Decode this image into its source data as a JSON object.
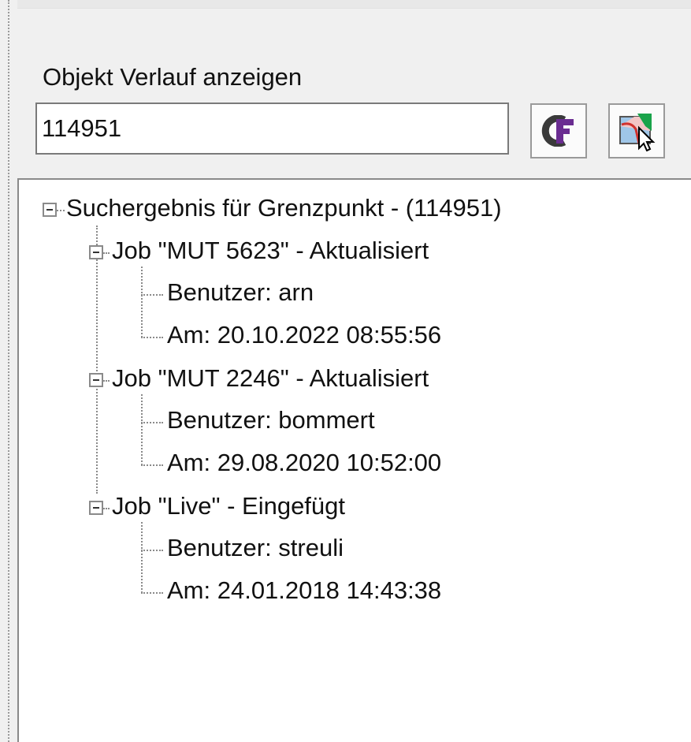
{
  "history_label": "Objekt Verlauf anzeigen",
  "search": {
    "value": "114951"
  },
  "buttons": {
    "history_icon": "history-search-icon",
    "map_icon": "map-locate-icon"
  },
  "tree": {
    "root": "Suchergebnis für Grenzpunkt - (114951)",
    "jobs": [
      {
        "label": "Job \"MUT 5623\" - Aktualisiert",
        "user": "Benutzer: arn",
        "date": "Am: 20.10.2022 08:55:56"
      },
      {
        "label": "Job \"MUT 2246\" - Aktualisiert",
        "user": "Benutzer: bommert",
        "date": "Am: 29.08.2020 10:52:00"
      },
      {
        "label": "Job \"Live\" - Eingefügt",
        "user": "Benutzer: streuli",
        "date": "Am: 24.01.2018 14:43:38"
      }
    ]
  },
  "colors": {
    "history_icon_purple": "#6a2c91",
    "history_icon_gray": "#3a3a3a",
    "map_green": "#19a34a",
    "map_red": "#d0312d",
    "map_blue": "#9fc6e8"
  }
}
